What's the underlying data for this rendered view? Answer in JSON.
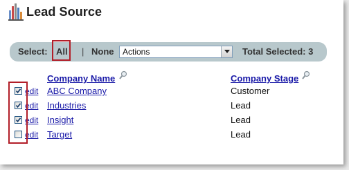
{
  "page": {
    "title": "Lead Source",
    "logo_icon": "bar-chart-icon"
  },
  "toolbar": {
    "select_label": "Select:",
    "all_label": "All",
    "separator": "|",
    "none_label": "None",
    "actions_value": "Actions",
    "total_selected": "Total Selected: 3"
  },
  "table": {
    "columns": [
      {
        "label": "Company Name",
        "icon": "magnifier-icon"
      },
      {
        "label": "Company Stage",
        "icon": "magnifier-icon"
      }
    ],
    "edit_label": "edit",
    "rows": [
      {
        "company": "ABC Company",
        "stage": "Customer",
        "checked": true
      },
      {
        "company": "Industries",
        "stage": "Lead",
        "checked": true
      },
      {
        "company": "Insight",
        "stage": "Lead",
        "checked": true
      },
      {
        "company": "Target",
        "stage": "Lead",
        "checked": false
      }
    ]
  },
  "colors": {
    "link": "#1a1aa8",
    "highlight_border": "#b21e28",
    "toolbar_bg": "#b8c8cc"
  }
}
